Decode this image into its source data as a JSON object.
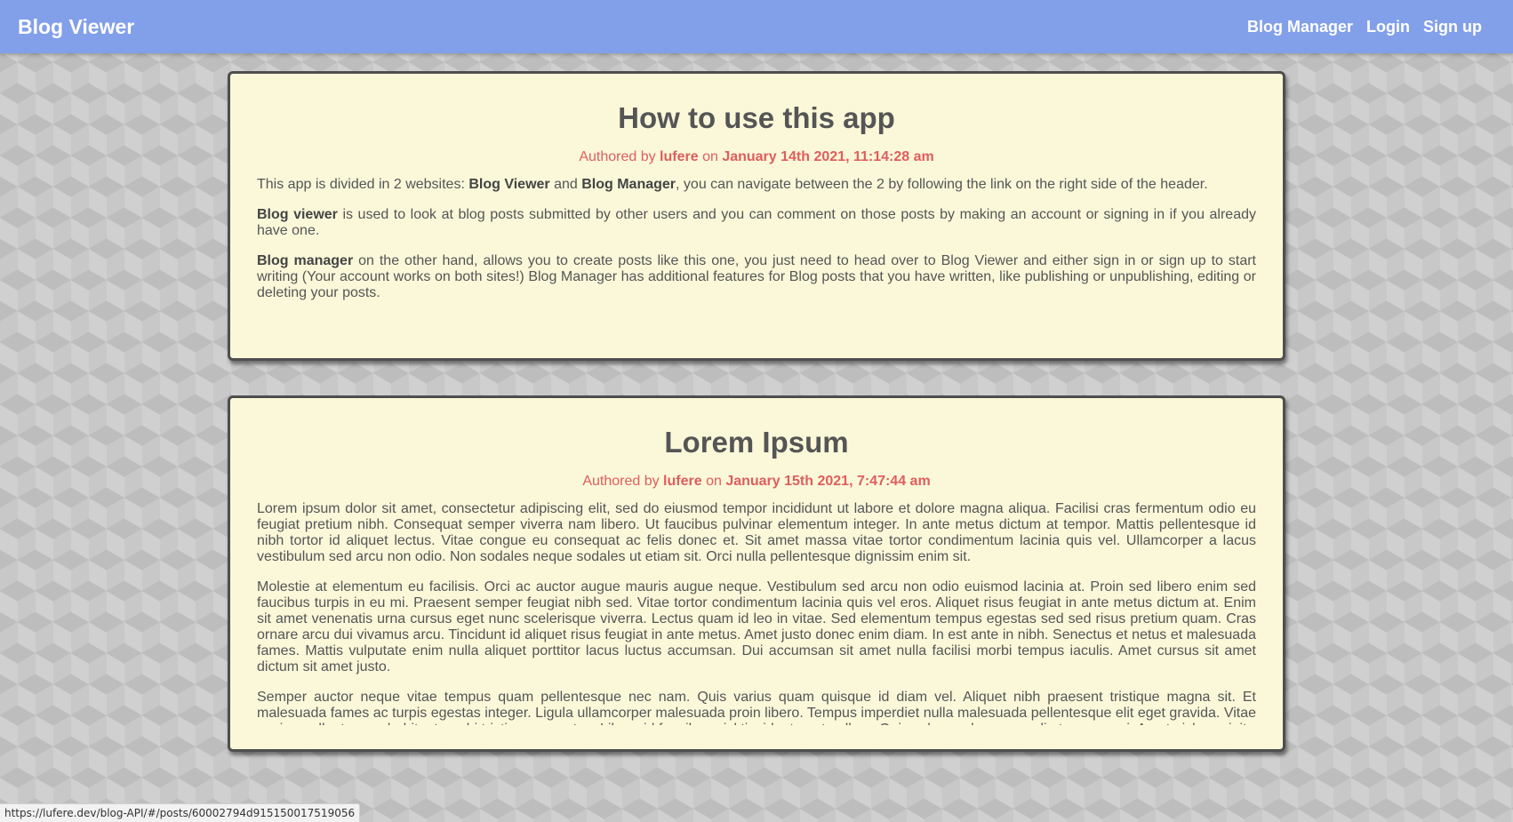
{
  "header": {
    "brand": "Blog Viewer",
    "nav": [
      "Blog Manager",
      "Login",
      "Sign up"
    ]
  },
  "colors": {
    "header_bg": "#829fea",
    "card_bg": "#faf8d9",
    "meta_accent": "#e05d5d"
  },
  "posts": [
    {
      "title": "How to use this app",
      "meta": {
        "prefix": "Authored by ",
        "author": "lufere",
        "on": " on ",
        "date": "January 14th 2021, 11:14:28 am"
      },
      "paragraphs": [
        [
          {
            "t": "This app is divided in 2 websites: "
          },
          {
            "t": "Blog Viewer",
            "b": true
          },
          {
            "t": " and "
          },
          {
            "t": "Blog Manager",
            "b": true
          },
          {
            "t": ", you can navigate between the 2 by following the link on the right side of the header."
          }
        ],
        [
          {
            "t": "Blog viewer",
            "b": true
          },
          {
            "t": " is used to look at blog posts submitted by other users and you can comment on those posts by making an account or signing in if you already have one."
          }
        ],
        [
          {
            "t": "Blog manager",
            "b": true
          },
          {
            "t": " on the other hand, allows you to create posts like this one, you just need to head over to Blog Viewer and either sign in or sign up to start writing (Your account works on both sites!) Blog Manager has additional features for Blog posts that you have written, like publishing or unpublishing, editing or deleting your posts."
          }
        ]
      ]
    },
    {
      "title": "Lorem Ipsum",
      "meta": {
        "prefix": "Authored by ",
        "author": "lufere",
        "on": " on ",
        "date": "January 15th 2021, 7:47:44 am"
      },
      "paragraphs": [
        [
          {
            "t": "Lorem ipsum dolor sit amet, consectetur adipiscing elit, sed do eiusmod tempor incididunt ut labore et dolore magna aliqua. Facilisi cras fermentum odio eu feugiat pretium nibh. Consequat semper viverra nam libero. Ut faucibus pulvinar elementum integer. In ante metus dictum at tempor. Mattis pellentesque id nibh tortor id aliquet lectus. Vitae congue eu consequat ac felis donec et. Sit amet massa vitae tortor condimentum lacinia quis vel. Ullamcorper a lacus vestibulum sed arcu non odio. Non sodales neque sodales ut etiam sit. Orci nulla pellentesque dignissim enim sit."
          }
        ],
        [
          {
            "t": "Molestie at elementum eu facilisis. Orci ac auctor augue mauris augue neque. Vestibulum sed arcu non odio euismod lacinia at. Proin sed libero enim sed faucibus turpis in eu mi. Praesent semper feugiat nibh sed. Vitae tortor condimentum lacinia quis vel eros. Aliquet risus feugiat in ante metus dictum at. Enim sit amet venenatis urna cursus eget nunc scelerisque viverra. Lectus quam id leo in vitae. Sed elementum tempus egestas sed sed risus pretium quam. Cras ornare arcu dui vivamus arcu. Tincidunt id aliquet risus feugiat in ante metus. Amet justo donec enim diam. In est ante in nibh. Senectus et netus et malesuada fames. Mattis vulputate enim nulla aliquet porttitor lacus luctus accumsan. Dui accumsan sit amet nulla facilisi morbi tempus iaculis. Amet cursus sit amet dictum sit amet justo."
          }
        ],
        [
          {
            "t": "Semper auctor neque vitae tempus quam pellentesque nec nam. Quis varius quam quisque id diam vel. Aliquet nibh praesent tristique magna sit. Et malesuada fames ac turpis egestas integer. Ligula ullamcorper malesuada proin libero. Tempus imperdiet nulla malesuada pellentesque elit eget gravida. Vitae sapien pellentesque habitant morbi tristique senectus. Libero id faucibus nisl tincidunt eget nullam. Quis vel eros donec ac odio tempor orci. Amet nisl suscipit"
          }
        ]
      ]
    }
  ],
  "status_bar": {
    "url": "https://lufere.dev/blog-API/#/posts/60002794d915150017519056"
  }
}
